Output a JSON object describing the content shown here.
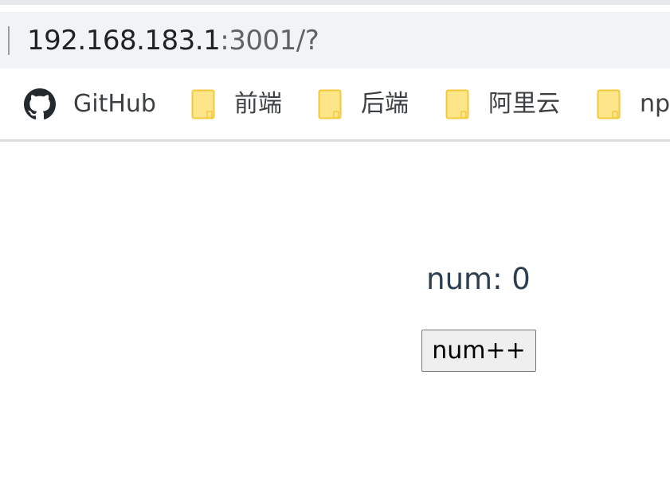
{
  "browser": {
    "url_host": "192.168.183.1",
    "url_rest": ":3001/?",
    "bookmarks": [
      {
        "label": "GitHub",
        "icon": "github-icon"
      },
      {
        "label": "前端",
        "icon": "folder-icon"
      },
      {
        "label": "后端",
        "icon": "folder-icon"
      },
      {
        "label": "阿里云",
        "icon": "folder-icon"
      },
      {
        "label": "np",
        "icon": "folder-icon"
      }
    ]
  },
  "page": {
    "num_text": "num: 0",
    "button_label": "num++"
  },
  "colors": {
    "folder_fill": "#fde68a",
    "folder_stroke": "#f3c93c",
    "text": "#2c3e50"
  }
}
